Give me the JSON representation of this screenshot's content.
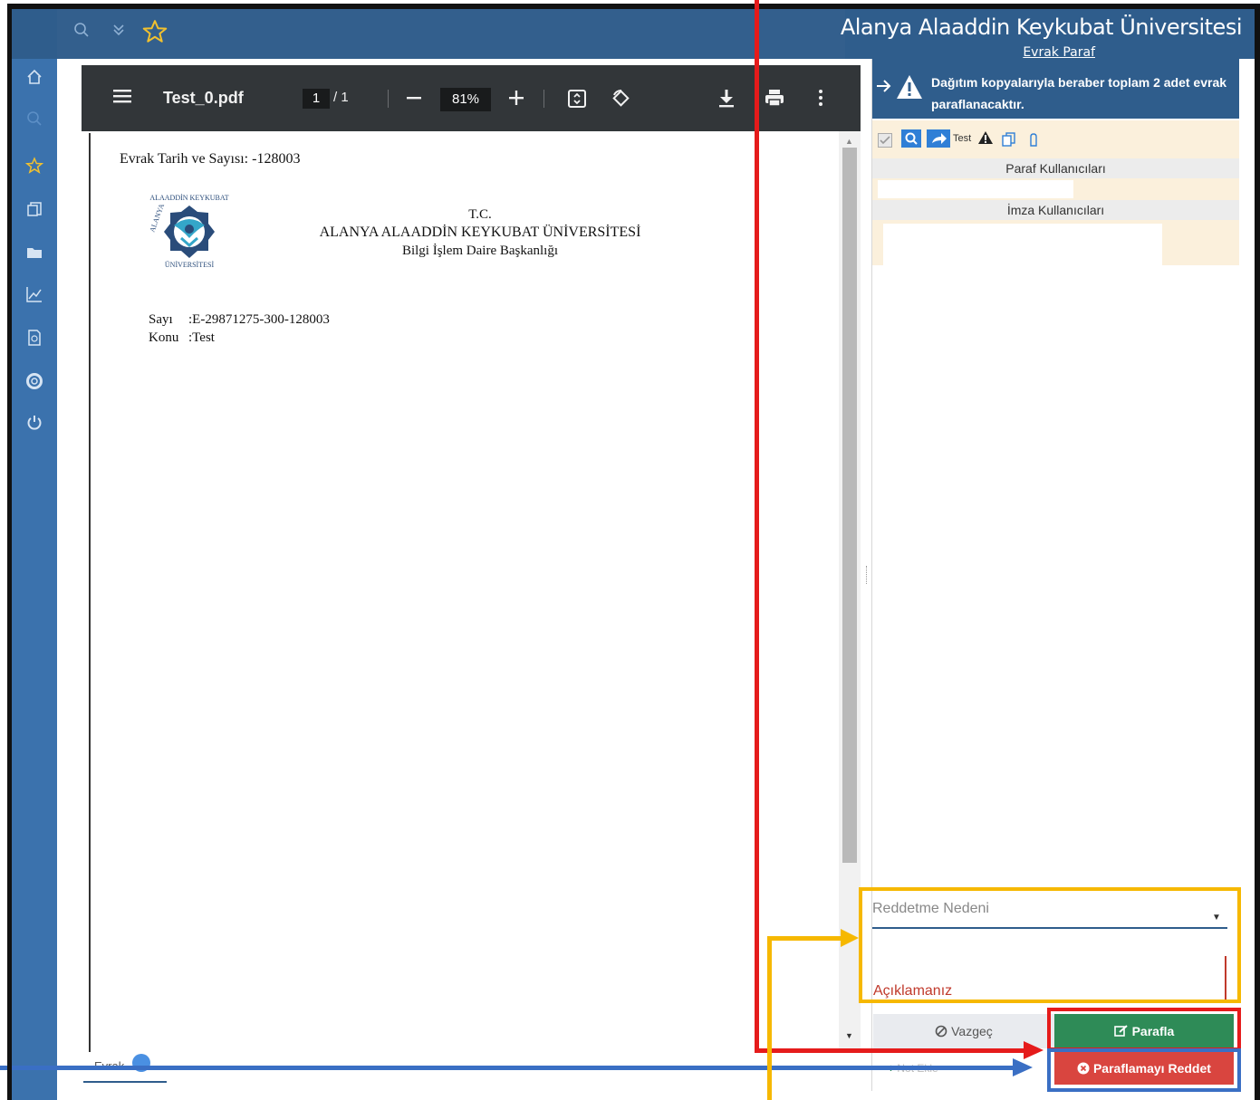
{
  "header": {
    "title": "Alanya Alaaddin Keykubat Üniversitesi",
    "subtitle": "Evrak Paraf",
    "icons": [
      "search-icon",
      "double-chevron-down-icon",
      "star-icon"
    ]
  },
  "sidebar": {
    "icons": [
      "home-icon",
      "search-icon",
      "star-icon",
      "copy-icon",
      "folder-icon",
      "chart-icon",
      "document-icon",
      "lifebuoy-icon",
      "power-icon"
    ]
  },
  "pdf_toolbar": {
    "file_name": "Test_0.pdf",
    "page_current": "1",
    "page_total": "/ 1",
    "zoom": "81%"
  },
  "document": {
    "date_number": "Evrak Tarih ve Sayısı: -128003",
    "org_line1": "T.C.",
    "org_line2": "ALANYA ALAADDİN KEYKUBAT ÜNİVERSİTESİ",
    "org_line3": "Bilgi İşlem Daire Başkanlığı",
    "sayi_label": "Sayı",
    "sayi_value": ":E-29871275-300-128003",
    "konu_label": "Konu",
    "konu_value": ":Test",
    "logo_text_top": "ALAADDİN KEYKUBAT",
    "logo_text_left": "ALANYA",
    "logo_text_bottom": "ÜNİVERSİTESİ"
  },
  "bottom_tab": {
    "label": "Evrak"
  },
  "panel": {
    "notice": "Dağıtım kopyalarıyla beraber toplam 2 adet evrak paraflanacaktır.",
    "file_tag": "Test",
    "paraf_users": "Paraf Kullanıcıları",
    "imza_users": "İmza Kullanıcıları",
    "reject_reason_label": "Reddetme Nedeni",
    "comment_label": "Açıklamanız",
    "cancel_button": "Vazgeç",
    "paraf_button": "Parafla",
    "reject_button": "Paraflamayı Reddet",
    "note_button": "Not Ekle"
  },
  "colors": {
    "header": "#2f5d8c",
    "sidebar": "#3b72ad",
    "parafla": "#2e8b57",
    "reddet": "#d9453f",
    "annotation_red": "#e51b1b",
    "annotation_blue": "#3a6fc4",
    "annotation_yellow": "#f6b800"
  }
}
